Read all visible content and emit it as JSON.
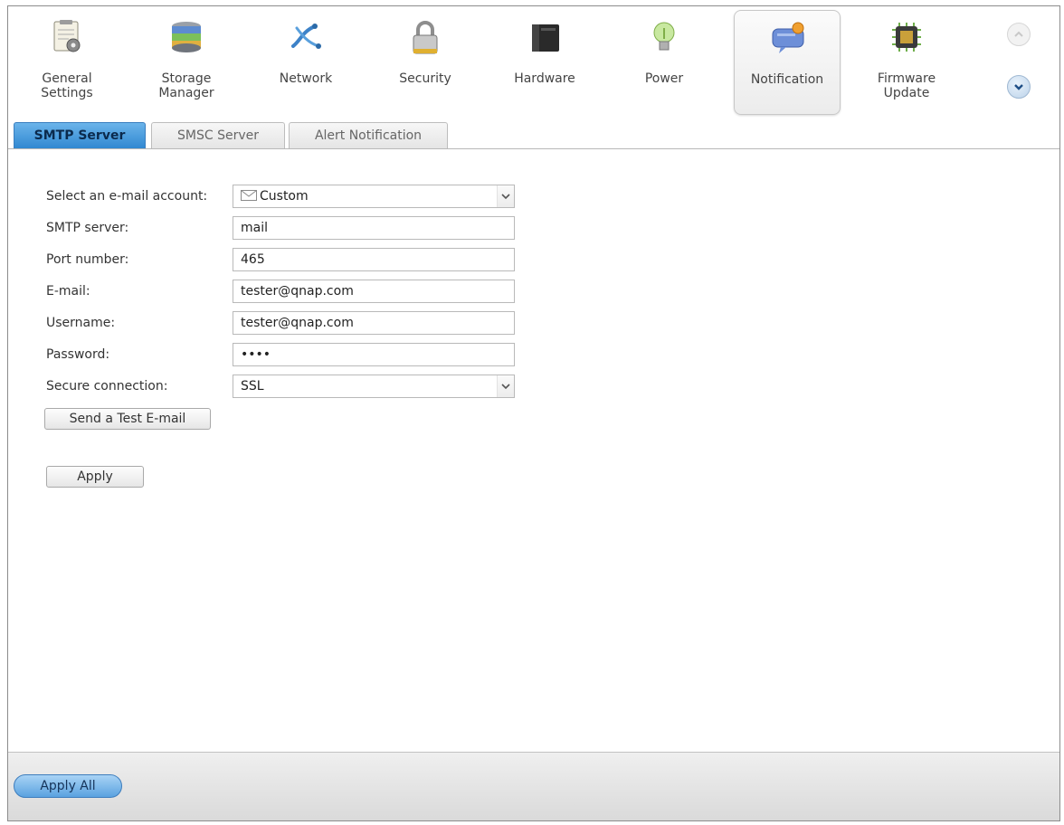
{
  "categories": [
    {
      "label": "General\nSettings",
      "icon": "general-settings-icon"
    },
    {
      "label": "Storage\nManager",
      "icon": "storage-manager-icon"
    },
    {
      "label": "Network",
      "icon": "network-icon"
    },
    {
      "label": "Security",
      "icon": "lock-icon"
    },
    {
      "label": "Hardware",
      "icon": "hardware-icon"
    },
    {
      "label": "Power",
      "icon": "lightbulb-icon"
    },
    {
      "label": "Notification",
      "icon": "notification-icon"
    },
    {
      "label": "Firmware\nUpdate",
      "icon": "firmware-chip-icon"
    }
  ],
  "selected_category": "Notification",
  "tabs": [
    {
      "label": "SMTP Server",
      "active": true
    },
    {
      "label": "SMSC Server",
      "active": false
    },
    {
      "label": "Alert Notification",
      "active": false
    }
  ],
  "form": {
    "account_label": "Select an e-mail account:",
    "account_value": "Custom",
    "smtp_label": "SMTP server:",
    "smtp_value": "mail",
    "port_label": "Port number:",
    "port_value": "465",
    "email_label": "E-mail:",
    "email_value": "tester@qnap.com",
    "username_label": "Username:",
    "username_value": "tester@qnap.com",
    "password_label": "Password:",
    "password_value": "••••",
    "secure_label": "Secure connection:",
    "secure_value": "SSL",
    "test_button": "Send a Test E-mail",
    "apply_button": "Apply"
  },
  "footer": {
    "apply_all": "Apply All"
  },
  "colors": {
    "active_tab": "#2e86d0",
    "apply_all": "#5aa2e0"
  }
}
